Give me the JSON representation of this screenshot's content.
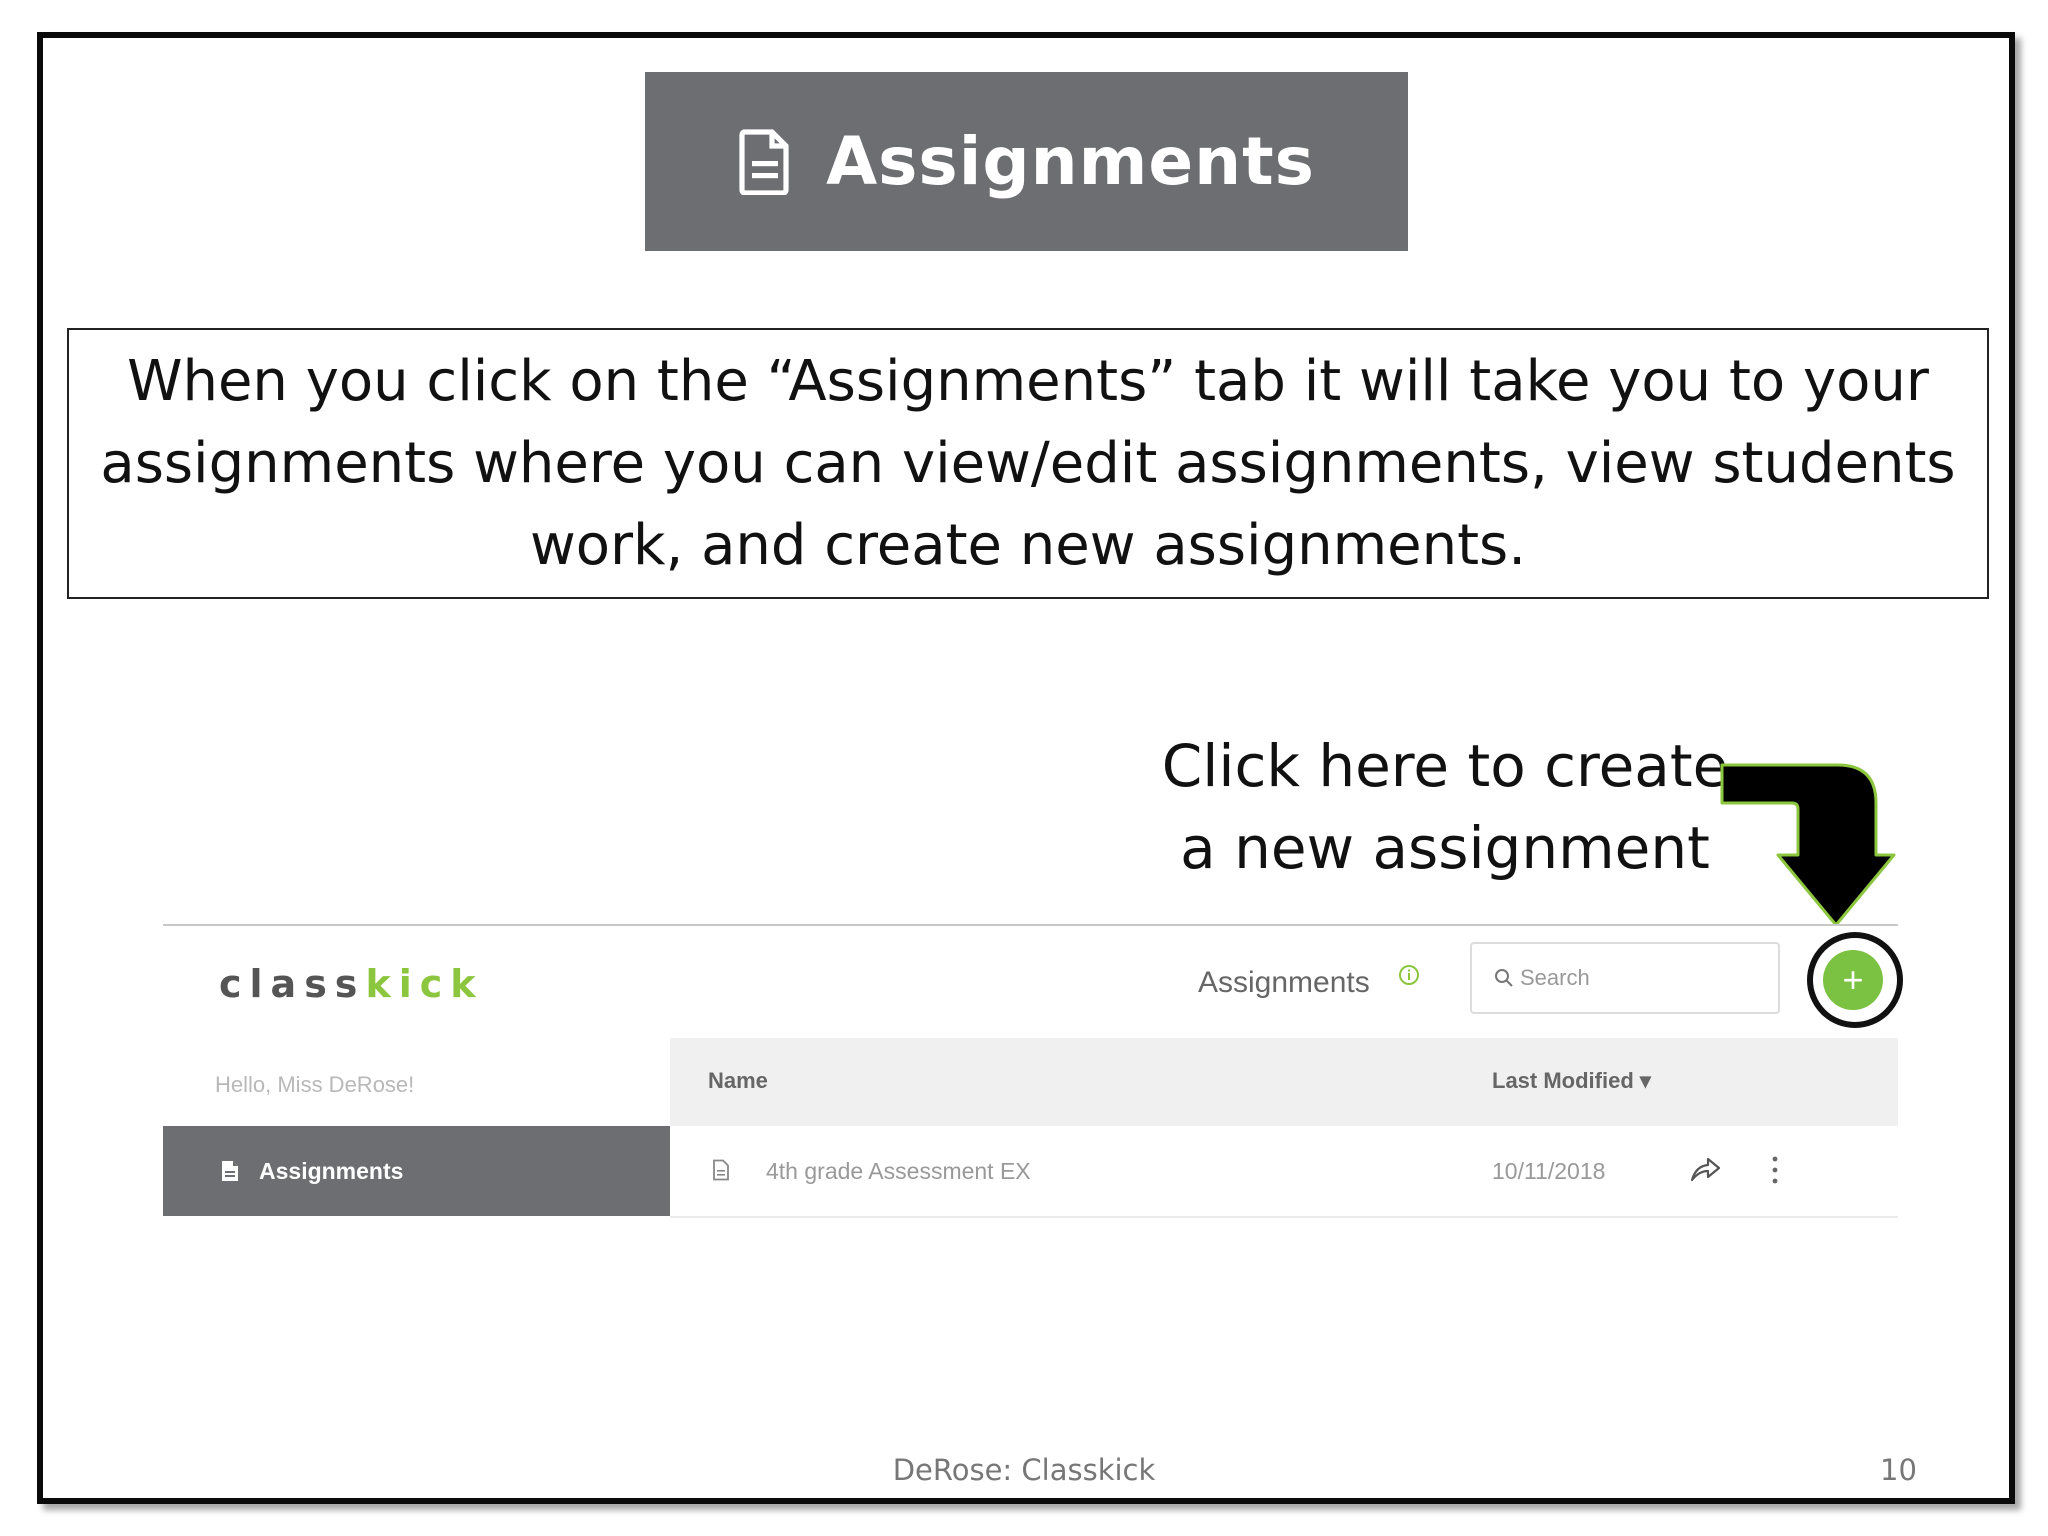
{
  "slide": {
    "header_label": "Assignments",
    "caption": "When you click on the “Assignments” tab it will take you to your assignments where you can view/edit assignments, view students work, and create new assignments.",
    "callout_line1": "Click here to create",
    "callout_line2": "a new assignment",
    "footer": "DeRose: Classkick",
    "page_number": "10"
  },
  "app": {
    "logo_part1": "class",
    "logo_part2": "kick",
    "greeting": "Hello, Miss DeRose!",
    "nav_item": "Assignments",
    "page_heading": "Assignments",
    "search_placeholder": "Search",
    "add_button": "+",
    "table": {
      "columns": [
        "Name",
        "Last Modified ▾"
      ],
      "rows": [
        {
          "name": "4th grade Assessment EX",
          "modified": "10/11/2018"
        }
      ]
    }
  },
  "colors": {
    "accent_green": "#7cc242",
    "sidebar_active": "#6d6e71",
    "arrow_outline": "#8cc63f"
  }
}
